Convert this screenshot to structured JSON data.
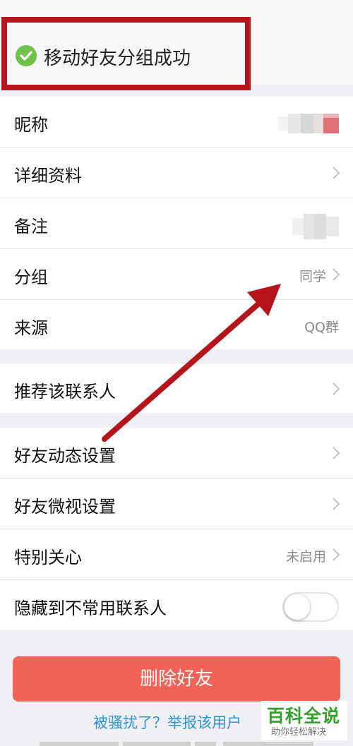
{
  "toast": {
    "message": "移动好友分组成功"
  },
  "profile_rows": [
    {
      "label": "昵称"
    },
    {
      "label": "详细资料"
    },
    {
      "label": "备注"
    },
    {
      "label": "分组",
      "value": "同学"
    },
    {
      "label": "来源",
      "value": "QQ群"
    }
  ],
  "recommend_row": {
    "label": "推荐该联系人"
  },
  "settings_rows": [
    {
      "label": "好友动态设置"
    },
    {
      "label": "好友微视设置"
    },
    {
      "label": "特别关心",
      "value": "未启用"
    },
    {
      "label": "隐藏到不常用联系人",
      "toggle_on": false
    }
  ],
  "delete_button": {
    "label": "删除好友"
  },
  "report_link": {
    "label": "被骚扰了？举报该用户"
  },
  "watermark": {
    "title": "百科全说",
    "subtitle": "助你轻松解决"
  },
  "colors": {
    "annotation_red": "#b5141a",
    "success_green": "#6ec24a",
    "delete_red": "#f36257",
    "link_blue": "#2a96d6",
    "watermark_green": "#33a02c"
  },
  "icons": {
    "success": "check-circle-icon",
    "chevron": "chevron-right-icon",
    "annotation": "red-arrow-icon"
  }
}
